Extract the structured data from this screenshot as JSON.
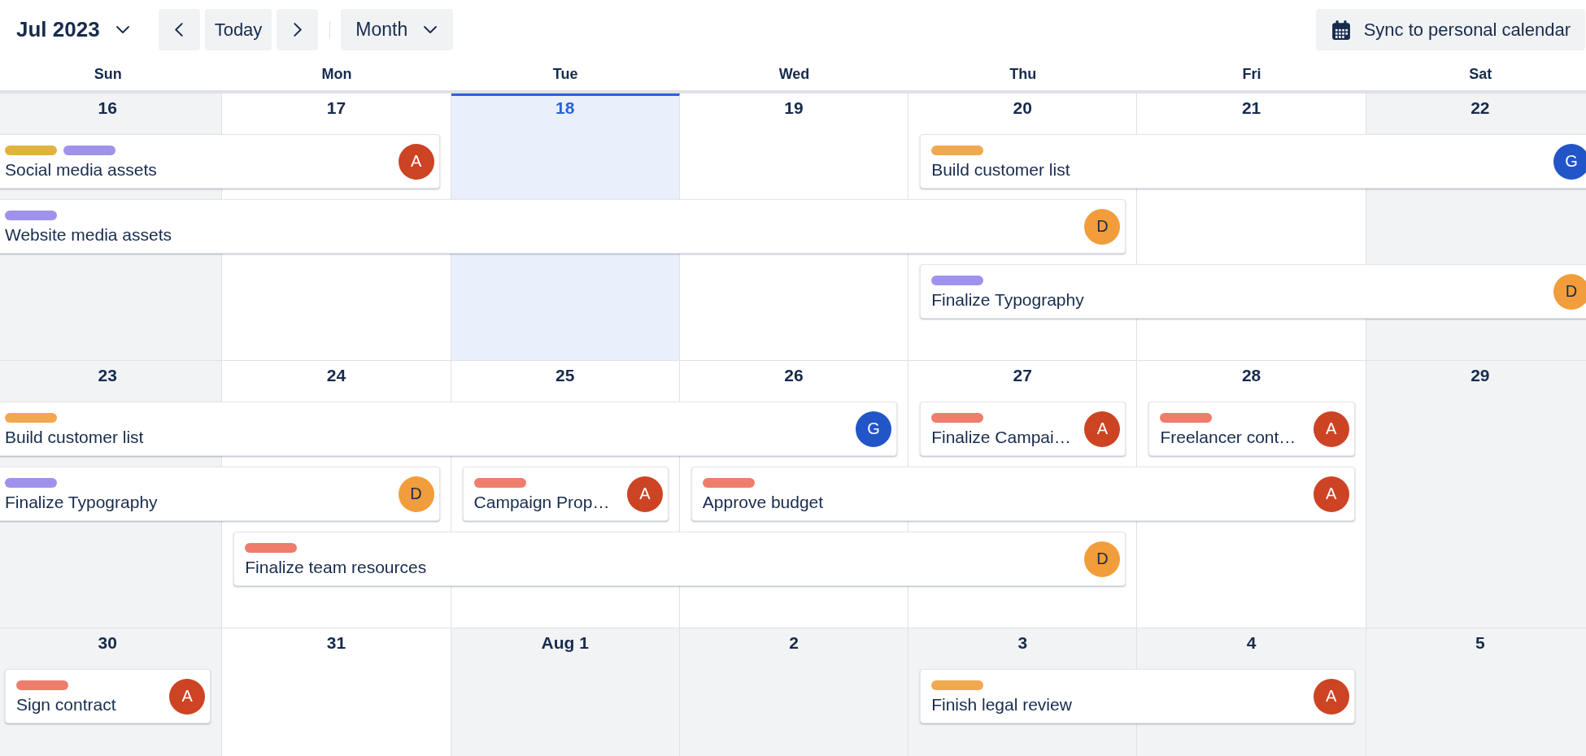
{
  "toolbar": {
    "period": "Jul 2023",
    "today_button": "Today",
    "view": "Month",
    "sync_button": "Sync to personal calendar"
  },
  "weekdays": [
    "Sun",
    "Mon",
    "Tue",
    "Wed",
    "Thu",
    "Fri",
    "Sat"
  ],
  "weeks": [
    {
      "days": [
        {
          "label": "16",
          "today": false,
          "shaded": true
        },
        {
          "label": "17",
          "today": false,
          "shaded": false
        },
        {
          "label": "18",
          "today": true,
          "shaded": false
        },
        {
          "label": "19",
          "today": false,
          "shaded": false
        },
        {
          "label": "20",
          "today": false,
          "shaded": false
        },
        {
          "label": "21",
          "today": false,
          "shaded": false
        },
        {
          "label": "22",
          "today": false,
          "shaded": true
        }
      ],
      "lanes": [
        [
          {
            "kind": "event",
            "title": "Social media assets",
            "continued_before": true,
            "continues_after": false,
            "tags": [
              {
                "color": "#e0b43c"
              },
              {
                "color": "#9f92ec"
              }
            ],
            "assignee": {
              "initial": "A",
              "color": "#cc4424"
            }
          },
          {
            "kind": "span"
          },
          {
            "kind": "free"
          },
          {
            "kind": "free"
          },
          {
            "kind": "event",
            "title": "Build customer list",
            "continued_before": false,
            "continues_after": true,
            "tags": [
              {
                "color": "#f2a84f"
              }
            ],
            "assignee": {
              "initial": "G",
              "color": "#2155c8"
            }
          },
          {
            "kind": "span"
          },
          {
            "kind": "span"
          }
        ],
        [
          {
            "kind": "event",
            "title": "Website media assets",
            "continued_before": true,
            "continues_after": false,
            "tags": [
              {
                "color": "#9f92ec"
              }
            ],
            "assignee": {
              "initial": "D",
              "color": "#f29d3b"
            }
          },
          {
            "kind": "span"
          },
          {
            "kind": "span"
          },
          {
            "kind": "span"
          },
          {
            "kind": "span"
          },
          {
            "kind": "free"
          },
          {
            "kind": "free"
          }
        ],
        [
          {
            "kind": "free"
          },
          {
            "kind": "free"
          },
          {
            "kind": "free"
          },
          {
            "kind": "free"
          },
          {
            "kind": "event",
            "title": "Finalize Typography",
            "continued_before": false,
            "continues_after": true,
            "tags": [
              {
                "color": "#9f92ec"
              }
            ],
            "assignee": {
              "initial": "D",
              "color": "#f29d3b"
            }
          },
          {
            "kind": "span"
          },
          {
            "kind": "span"
          }
        ]
      ]
    },
    {
      "days": [
        {
          "label": "23",
          "today": false,
          "shaded": true
        },
        {
          "label": "24",
          "today": false,
          "shaded": false
        },
        {
          "label": "25",
          "today": false,
          "shaded": false
        },
        {
          "label": "26",
          "today": false,
          "shaded": false
        },
        {
          "label": "27",
          "today": false,
          "shaded": false
        },
        {
          "label": "28",
          "today": false,
          "shaded": false
        },
        {
          "label": "29",
          "today": false,
          "shaded": true
        }
      ],
      "lanes": [
        [
          {
            "kind": "event",
            "title": "Build customer list",
            "continued_before": true,
            "continues_after": false,
            "tags": [
              {
                "color": "#f2a84f"
              }
            ],
            "assignee": {
              "initial": "G",
              "color": "#2155c8"
            }
          },
          {
            "kind": "span"
          },
          {
            "kind": "span"
          },
          {
            "kind": "span"
          },
          {
            "kind": "event",
            "title": "Finalize Campai…",
            "continued_before": false,
            "continues_after": false,
            "tags": [
              {
                "color": "#ee7d6b"
              }
            ],
            "assignee": {
              "initial": "A",
              "color": "#cc4424"
            }
          },
          {
            "kind": "event",
            "title": "Freelancer cont…",
            "continued_before": false,
            "continues_after": false,
            "tags": [
              {
                "color": "#ee7d6b"
              }
            ],
            "assignee": {
              "initial": "A",
              "color": "#cc4424"
            }
          },
          {
            "kind": "free"
          }
        ],
        [
          {
            "kind": "event",
            "title": "Finalize Typography",
            "continued_before": true,
            "continues_after": false,
            "tags": [
              {
                "color": "#9f92ec"
              }
            ],
            "assignee": {
              "initial": "D",
              "color": "#f29d3b"
            }
          },
          {
            "kind": "span"
          },
          {
            "kind": "event",
            "title": "Campaign Prop…",
            "continued_before": false,
            "continues_after": false,
            "tags": [
              {
                "color": "#ee7d6b"
              }
            ],
            "assignee": {
              "initial": "A",
              "color": "#cc4424"
            }
          },
          {
            "kind": "event",
            "title": "Approve budget",
            "continued_before": false,
            "continues_after": false,
            "tags": [
              {
                "color": "#ee7d6b"
              }
            ],
            "assignee": {
              "initial": "A",
              "color": "#cc4424"
            }
          },
          {
            "kind": "span"
          },
          {
            "kind": "span"
          },
          {
            "kind": "free"
          }
        ],
        [
          {
            "kind": "free"
          },
          {
            "kind": "event",
            "title": "Finalize team resources",
            "continued_before": false,
            "continues_after": false,
            "tags": [
              {
                "color": "#ee7d6b"
              }
            ],
            "assignee": {
              "initial": "D",
              "color": "#f29d3b"
            }
          },
          {
            "kind": "span"
          },
          {
            "kind": "span"
          },
          {
            "kind": "span"
          },
          {
            "kind": "free"
          },
          {
            "kind": "free"
          }
        ]
      ]
    },
    {
      "days": [
        {
          "label": "30",
          "today": false,
          "shaded": true
        },
        {
          "label": "31",
          "today": false,
          "shaded": false
        },
        {
          "label": "Aug 1",
          "today": false,
          "shaded": true
        },
        {
          "label": "2",
          "today": false,
          "shaded": true
        },
        {
          "label": "3",
          "today": false,
          "shaded": true
        },
        {
          "label": "4",
          "today": false,
          "shaded": true
        },
        {
          "label": "5",
          "today": false,
          "shaded": true
        }
      ],
      "lanes": [
        [
          {
            "kind": "event",
            "title": "Sign contract",
            "continued_before": false,
            "continues_after": false,
            "tags": [
              {
                "color": "#ee7d6b"
              }
            ],
            "assignee": {
              "initial": "A",
              "color": "#cc4424"
            }
          },
          {
            "kind": "free"
          },
          {
            "kind": "free"
          },
          {
            "kind": "free"
          },
          {
            "kind": "event",
            "title": "Finish legal review",
            "continued_before": false,
            "continues_after": false,
            "tags": [
              {
                "color": "#f2a84f"
              }
            ],
            "assignee": {
              "initial": "A",
              "color": "#cc4424"
            }
          },
          {
            "kind": "span"
          },
          {
            "kind": "free"
          }
        ]
      ]
    }
  ]
}
